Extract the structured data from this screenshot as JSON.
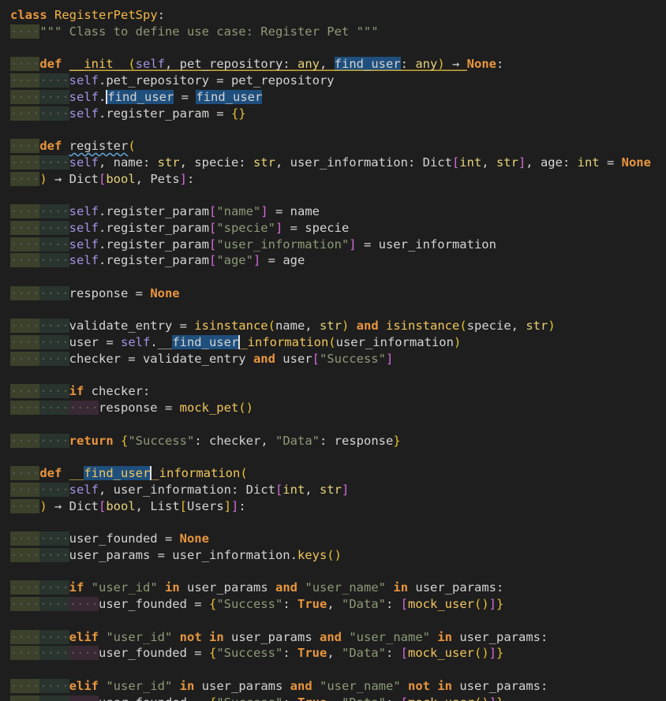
{
  "editor": {
    "lines": [
      [
        [
          "class",
          "kw"
        ],
        [
          " ",
          "txt"
        ],
        [
          "RegisterPetSpy",
          "cls"
        ],
        [
          ":",
          "op"
        ]
      ],
      [
        [
          "····",
          "ws",
          "i1"
        ],
        [
          "\"\"\" Class to define use case: Register Pet \"\"\"",
          "cmt"
        ]
      ],
      [],
      [
        [
          "····",
          "ws",
          "i1"
        ],
        [
          "def",
          "kw"
        ],
        [
          " ",
          "txt"
        ],
        [
          "__init__",
          "fn"
        ],
        [
          "(",
          "br"
        ],
        [
          "self",
          "self"
        ],
        [
          ", pet_repository: ",
          "prm"
        ],
        [
          "any",
          "type"
        ],
        [
          ", ",
          "op"
        ],
        [
          "find_user",
          "prm",
          "hl"
        ],
        [
          ": ",
          "op"
        ],
        [
          "any",
          "type"
        ],
        [
          ")",
          "br"
        ],
        [
          " → ",
          "op"
        ],
        [
          "None",
          "cst"
        ],
        [
          ":",
          "op"
        ]
      ],
      [
        [
          "····",
          "ws",
          "i1"
        ],
        [
          "····",
          "ws",
          "i2"
        ],
        [
          "self",
          "self"
        ],
        [
          ".pet_repository = pet_repository",
          "txt"
        ]
      ],
      [
        [
          "····",
          "ws",
          "i1"
        ],
        [
          "····",
          "ws",
          "i2"
        ],
        [
          "self",
          "self"
        ],
        [
          ".",
          "op"
        ],
        [
          "find_user",
          "txt",
          "hl"
        ],
        [
          " = ",
          "op"
        ],
        [
          "find_user",
          "txt",
          "hl"
        ]
      ],
      [
        [
          "····",
          "ws",
          "i1"
        ],
        [
          "····",
          "ws",
          "i2"
        ],
        [
          "self",
          "self"
        ],
        [
          ".register_param = ",
          "txt"
        ],
        [
          "{}",
          "br"
        ]
      ],
      [],
      [
        [
          "····",
          "ws",
          "i1"
        ],
        [
          "def",
          "kw"
        ],
        [
          " ",
          "txt"
        ],
        [
          "register",
          "fn"
        ],
        [
          "(",
          "br"
        ]
      ],
      [
        [
          "····",
          "ws",
          "i1"
        ],
        [
          "····",
          "ws",
          "i2"
        ],
        [
          "self",
          "self"
        ],
        [
          ", name: ",
          "prm"
        ],
        [
          "str",
          "type"
        ],
        [
          ", specie: ",
          "prm"
        ],
        [
          "str",
          "type"
        ],
        [
          ", user_information: Dict",
          "prm"
        ],
        [
          "[",
          "br2"
        ],
        [
          "int",
          "type"
        ],
        [
          ", ",
          "op"
        ],
        [
          "str",
          "type"
        ],
        [
          "]",
          "br2"
        ],
        [
          ", age: ",
          "prm"
        ],
        [
          "int",
          "type"
        ],
        [
          " = ",
          "op"
        ],
        [
          "None",
          "cst"
        ]
      ],
      [
        [
          "····",
          "ws",
          "i1"
        ],
        [
          ")",
          "br"
        ],
        [
          " → Dict",
          "txt"
        ],
        [
          "[",
          "br2"
        ],
        [
          "bool",
          "type"
        ],
        [
          ", Pets",
          "txt"
        ],
        [
          "]",
          "br2"
        ],
        [
          ":",
          "op"
        ]
      ],
      [],
      [
        [
          "····",
          "ws",
          "i1"
        ],
        [
          "····",
          "ws",
          "i2"
        ],
        [
          "self",
          "self"
        ],
        [
          ".register_param",
          "txt"
        ],
        [
          "[",
          "br2"
        ],
        [
          "\"name\"",
          "str"
        ],
        [
          "]",
          "br2"
        ],
        [
          " = name",
          "txt"
        ]
      ],
      [
        [
          "····",
          "ws",
          "i1"
        ],
        [
          "····",
          "ws",
          "i2"
        ],
        [
          "self",
          "self"
        ],
        [
          ".register_param",
          "txt"
        ],
        [
          "[",
          "br2"
        ],
        [
          "\"specie\"",
          "str"
        ],
        [
          "]",
          "br2"
        ],
        [
          " = specie",
          "txt"
        ]
      ],
      [
        [
          "····",
          "ws",
          "i1"
        ],
        [
          "····",
          "ws",
          "i2"
        ],
        [
          "self",
          "self"
        ],
        [
          ".register_param",
          "txt"
        ],
        [
          "[",
          "br2"
        ],
        [
          "\"user_information\"",
          "str"
        ],
        [
          "]",
          "br2"
        ],
        [
          " = user_information",
          "txt"
        ]
      ],
      [
        [
          "····",
          "ws",
          "i1"
        ],
        [
          "····",
          "ws",
          "i2"
        ],
        [
          "self",
          "self"
        ],
        [
          ".register_param",
          "txt"
        ],
        [
          "[",
          "br2"
        ],
        [
          "\"age\"",
          "str"
        ],
        [
          "]",
          "br2"
        ],
        [
          " = age",
          "txt"
        ]
      ],
      [],
      [
        [
          "····",
          "ws",
          "i1"
        ],
        [
          "····",
          "ws",
          "i2"
        ],
        [
          "response = ",
          "txt"
        ],
        [
          "None",
          "cst"
        ]
      ],
      [],
      [
        [
          "····",
          "ws",
          "i1"
        ],
        [
          "····",
          "ws",
          "i2"
        ],
        [
          "validate_entry = ",
          "txt"
        ],
        [
          "isinstance",
          "fn"
        ],
        [
          "(",
          "br"
        ],
        [
          "name, ",
          "txt"
        ],
        [
          "str",
          "type"
        ],
        [
          ")",
          "br"
        ],
        [
          " ",
          "txt"
        ],
        [
          "and",
          "kw"
        ],
        [
          " ",
          "txt"
        ],
        [
          "isinstance",
          "fn"
        ],
        [
          "(",
          "br"
        ],
        [
          "specie, ",
          "txt"
        ],
        [
          "str",
          "type"
        ],
        [
          ")",
          "br"
        ]
      ],
      [
        [
          "····",
          "ws",
          "i1"
        ],
        [
          "····",
          "ws",
          "i2"
        ],
        [
          "user = ",
          "txt"
        ],
        [
          "self",
          "self"
        ],
        [
          ".__",
          "txt"
        ],
        [
          "find_user",
          "txt",
          "hl"
        ],
        [
          "_information",
          "fn"
        ],
        [
          "(",
          "br"
        ],
        [
          "user_information",
          "txt"
        ],
        [
          ")",
          "br"
        ]
      ],
      [
        [
          "····",
          "ws",
          "i1"
        ],
        [
          "····",
          "ws",
          "i2"
        ],
        [
          "checker = validate_entry ",
          "txt"
        ],
        [
          "and",
          "kw"
        ],
        [
          " user",
          "txt"
        ],
        [
          "[",
          "br2"
        ],
        [
          "\"Success\"",
          "str"
        ],
        [
          "]",
          "br2"
        ]
      ],
      [],
      [
        [
          "····",
          "ws",
          "i1"
        ],
        [
          "····",
          "ws",
          "i2"
        ],
        [
          "if",
          "kw"
        ],
        [
          " checker:",
          "txt"
        ]
      ],
      [
        [
          "····",
          "ws",
          "i1"
        ],
        [
          "····",
          "ws",
          "i2"
        ],
        [
          "····",
          "ws",
          "i3"
        ],
        [
          "response = ",
          "txt"
        ],
        [
          "mock_pet",
          "fn"
        ],
        [
          "()",
          "br"
        ]
      ],
      [],
      [
        [
          "····",
          "ws",
          "i1"
        ],
        [
          "····",
          "ws",
          "i2"
        ],
        [
          "return",
          "kw"
        ],
        [
          " ",
          "txt"
        ],
        [
          "{",
          "br"
        ],
        [
          "\"Success\"",
          "str"
        ],
        [
          ": checker, ",
          "txt"
        ],
        [
          "\"Data\"",
          "str"
        ],
        [
          ": response",
          "txt"
        ],
        [
          "}",
          "br"
        ]
      ],
      [],
      [
        [
          "····",
          "ws",
          "i1"
        ],
        [
          "def",
          "kw"
        ],
        [
          " ",
          "txt"
        ],
        [
          "__",
          "fn"
        ],
        [
          "find_user",
          "fn",
          "hl"
        ],
        [
          "_information",
          "fn"
        ],
        [
          "(",
          "br"
        ]
      ],
      [
        [
          "····",
          "ws",
          "i1"
        ],
        [
          "····",
          "ws",
          "i2"
        ],
        [
          "self",
          "self"
        ],
        [
          ", user_information: Dict",
          "prm"
        ],
        [
          "[",
          "br2"
        ],
        [
          "int",
          "type"
        ],
        [
          ", ",
          "op"
        ],
        [
          "str",
          "type"
        ],
        [
          "]",
          "br2"
        ]
      ],
      [
        [
          "····",
          "ws",
          "i1"
        ],
        [
          ")",
          "br"
        ],
        [
          " → Dict",
          "txt"
        ],
        [
          "[",
          "br2"
        ],
        [
          "bool",
          "type"
        ],
        [
          ", List",
          "txt"
        ],
        [
          "[",
          "br"
        ],
        [
          "Users",
          "txt"
        ],
        [
          "]",
          "br"
        ],
        [
          "]",
          "br2"
        ],
        [
          ":",
          "op"
        ]
      ],
      [],
      [
        [
          "····",
          "ws",
          "i1"
        ],
        [
          "····",
          "ws",
          "i2"
        ],
        [
          "user_founded = ",
          "txt"
        ],
        [
          "None",
          "cst"
        ]
      ],
      [
        [
          "····",
          "ws",
          "i1"
        ],
        [
          "····",
          "ws",
          "i2"
        ],
        [
          "user_params = user_information.",
          "txt"
        ],
        [
          "keys",
          "fn"
        ],
        [
          "()",
          "br"
        ]
      ],
      [],
      [
        [
          "····",
          "ws",
          "i1"
        ],
        [
          "····",
          "ws",
          "i2"
        ],
        [
          "if",
          "kw"
        ],
        [
          " ",
          "txt"
        ],
        [
          "\"user_id\"",
          "str"
        ],
        [
          " ",
          "txt"
        ],
        [
          "in",
          "kw"
        ],
        [
          " user_params ",
          "txt"
        ],
        [
          "and",
          "kw"
        ],
        [
          " ",
          "txt"
        ],
        [
          "\"user_name\"",
          "str"
        ],
        [
          " ",
          "txt"
        ],
        [
          "in",
          "kw"
        ],
        [
          " user_params:",
          "txt"
        ]
      ],
      [
        [
          "····",
          "ws",
          "i1"
        ],
        [
          "····",
          "ws",
          "i2"
        ],
        [
          "····",
          "ws",
          "i3"
        ],
        [
          "user_founded = ",
          "txt"
        ],
        [
          "{",
          "br"
        ],
        [
          "\"Success\"",
          "str"
        ],
        [
          ": ",
          "txt"
        ],
        [
          "True",
          "cst"
        ],
        [
          ", ",
          "txt"
        ],
        [
          "\"Data\"",
          "str"
        ],
        [
          ": ",
          "txt"
        ],
        [
          "[",
          "br2"
        ],
        [
          "mock_user",
          "fn"
        ],
        [
          "()",
          "br"
        ],
        [
          "]",
          "br2"
        ],
        [
          "}",
          "br"
        ]
      ],
      [],
      [
        [
          "····",
          "ws",
          "i1"
        ],
        [
          "····",
          "ws",
          "i2"
        ],
        [
          "elif",
          "kw"
        ],
        [
          " ",
          "txt"
        ],
        [
          "\"user_id\"",
          "str"
        ],
        [
          " ",
          "txt"
        ],
        [
          "not in",
          "kw"
        ],
        [
          " user_params ",
          "txt"
        ],
        [
          "and",
          "kw"
        ],
        [
          " ",
          "txt"
        ],
        [
          "\"user_name\"",
          "str"
        ],
        [
          " ",
          "txt"
        ],
        [
          "in",
          "kw"
        ],
        [
          " user_params:",
          "txt"
        ]
      ],
      [
        [
          "····",
          "ws",
          "i1"
        ],
        [
          "····",
          "ws",
          "i2"
        ],
        [
          "····",
          "ws",
          "i3"
        ],
        [
          "user_founded = ",
          "txt"
        ],
        [
          "{",
          "br"
        ],
        [
          "\"Success\"",
          "str"
        ],
        [
          ": ",
          "txt"
        ],
        [
          "True",
          "cst"
        ],
        [
          ", ",
          "txt"
        ],
        [
          "\"Data\"",
          "str"
        ],
        [
          ": ",
          "txt"
        ],
        [
          "[",
          "br2"
        ],
        [
          "mock_user",
          "fn"
        ],
        [
          "()",
          "br"
        ],
        [
          "]",
          "br2"
        ],
        [
          "}",
          "br"
        ]
      ],
      [],
      [
        [
          "····",
          "ws",
          "i1"
        ],
        [
          "····",
          "ws",
          "i2"
        ],
        [
          "elif",
          "kw"
        ],
        [
          " ",
          "txt"
        ],
        [
          "\"user_id\"",
          "str"
        ],
        [
          " ",
          "txt"
        ],
        [
          "in",
          "kw"
        ],
        [
          " user_params ",
          "txt"
        ],
        [
          "and",
          "kw"
        ],
        [
          " ",
          "txt"
        ],
        [
          "\"user_name\"",
          "str"
        ],
        [
          " ",
          "txt"
        ],
        [
          "not in",
          "kw"
        ],
        [
          " user_params:",
          "txt"
        ]
      ],
      [
        [
          "····",
          "ws",
          "i1"
        ],
        [
          "····",
          "ws",
          "i2"
        ],
        [
          "····",
          "ws",
          "i3"
        ],
        [
          "user_founded = ",
          "txt"
        ],
        [
          "{",
          "br"
        ],
        [
          "\"Success\"",
          "str"
        ],
        [
          ": ",
          "txt"
        ],
        [
          "True",
          "cst"
        ],
        [
          ", ",
          "txt"
        ],
        [
          "\"Data\"",
          "str"
        ],
        [
          ": ",
          "txt"
        ],
        [
          "[",
          "br2"
        ],
        [
          "mock_user",
          "fn"
        ],
        [
          "()",
          "br"
        ],
        [
          "]",
          "br2"
        ],
        [
          "}",
          "br"
        ]
      ]
    ]
  }
}
